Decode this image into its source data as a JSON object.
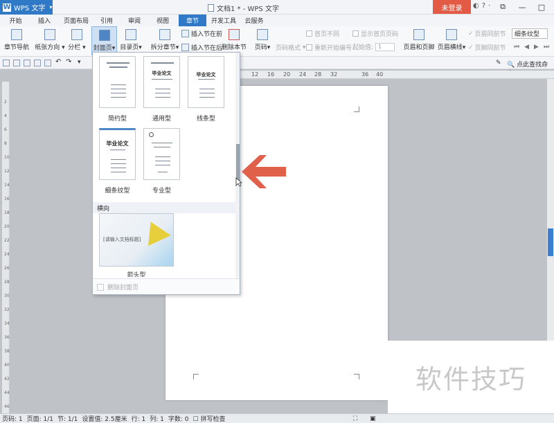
{
  "window": {
    "app_name": "WPS 文字",
    "title": "文档1 * - WPS 文字",
    "login_button": "未登录",
    "controls": [
      "—",
      "□",
      "✕"
    ]
  },
  "menu_tabs": [
    {
      "label": "开始",
      "active": false
    },
    {
      "label": "插入",
      "active": false
    },
    {
      "label": "页面布局",
      "active": false
    },
    {
      "label": "引用",
      "active": false
    },
    {
      "label": "审阅",
      "active": false
    },
    {
      "label": "视图",
      "active": false
    },
    {
      "label": "章节",
      "active": true
    },
    {
      "label": "开发工具",
      "active": false
    },
    {
      "label": "云服务",
      "active": false
    }
  ],
  "ribbon": {
    "chapter_nav": "章节导航",
    "paper_orientation": "纸张方向",
    "columns": "分栏",
    "cover_page": "封面页",
    "toc_page": "目录页",
    "split_section": "拆分章节",
    "insert_section_before": "插入节在前",
    "insert_section_after": "插入节在后",
    "delete_section": "删除本节",
    "page_number": "页码",
    "page_number_format": "页码格式",
    "first_page_different": "首页不同",
    "show_first_page_number": "显示首页页码",
    "restart_numbering": "重新开始编号",
    "start_value_label": "起始值:",
    "start_value": "1",
    "header_footer": "页眉和页脚",
    "header_line": "页眉横线",
    "same_as_prev_header": "页眉同前节",
    "same_as_prev_footer": "页脚同前节",
    "style_value": "细条纹型"
  },
  "quickbar": {
    "command_search": "点此查找命令"
  },
  "ruler_numbers": [
    "12",
    "16",
    "20",
    "24",
    "28",
    "32",
    "36",
    "40"
  ],
  "vertical_ruler_marks": [
    "2",
    "4",
    "6",
    "8",
    "10",
    "12",
    "14",
    "16",
    "18",
    "20",
    "22",
    "24",
    "26",
    "28",
    "30",
    "32",
    "34",
    "36",
    "38",
    "40",
    "42",
    "44",
    "46"
  ],
  "cover_dropdown": {
    "templates": [
      {
        "label": "简约型"
      },
      {
        "label": "通用型",
        "thumb_title": "毕业论文"
      },
      {
        "label": "线条型",
        "thumb_title": "毕业论文"
      },
      {
        "label": "细条纹型",
        "thumb_title": "毕业论文"
      },
      {
        "label": "专业型"
      }
    ],
    "landscape_section": "横向",
    "landscape_templates": [
      {
        "label": "箭头型",
        "thumb_caption": "[请输入文档标题]"
      }
    ],
    "delete_cover": "删除封面页"
  },
  "statusbar": {
    "page_num": "页码: 1",
    "pages": "页面: 1/1",
    "section": "节: 1/1",
    "setting": "设置值: 2.5厘米",
    "row": "行: 1",
    "col": "列: 1",
    "word_count": "字数: 0",
    "spell_check": "拼写检查"
  },
  "watermark": "软件技巧",
  "colors": {
    "accent": "#2f79c6",
    "login": "#e35a45",
    "arrow": "#e0604a"
  }
}
